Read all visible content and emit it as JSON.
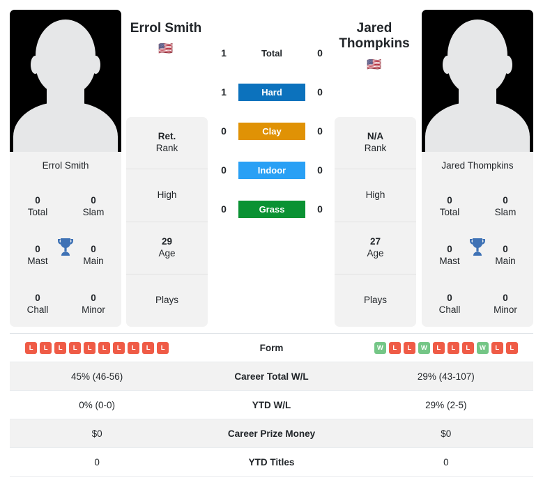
{
  "colors": {
    "hard": "#0c72bd",
    "clay": "#e09205",
    "indoor": "#29a0f5",
    "grass": "#0a9233",
    "win": "#74c686",
    "loss": "#ef5b46",
    "trophy": "#3f72b5",
    "card_bg": "#f2f2f2",
    "photo_bg": "#000000"
  },
  "players": {
    "left": {
      "name": "Errol Smith",
      "flag": "🇺🇸",
      "card_name": "Errol Smith",
      "titles": [
        {
          "value": "0",
          "label": "Total"
        },
        {
          "value": "0",
          "label": "Slam"
        },
        {
          "value": "0",
          "label": "Mast"
        },
        {
          "value": "0",
          "label": "Main"
        },
        {
          "value": "0",
          "label": "Chall"
        },
        {
          "value": "0",
          "label": "Minor"
        }
      ],
      "info": [
        {
          "value": "Ret.",
          "label": "Rank"
        },
        {
          "value": "",
          "label": "High"
        },
        {
          "value": "29",
          "label": "Age"
        },
        {
          "value": "",
          "label": "Plays"
        }
      ],
      "form": [
        "L",
        "L",
        "L",
        "L",
        "L",
        "L",
        "L",
        "L",
        "L",
        "L"
      ]
    },
    "right": {
      "name": "Jared Thompkins",
      "name_line1": "Jared",
      "name_line2": "Thompkins",
      "flag": "🇺🇸",
      "card_name": "Jared Thompkins",
      "titles": [
        {
          "value": "0",
          "label": "Total"
        },
        {
          "value": "0",
          "label": "Slam"
        },
        {
          "value": "0",
          "label": "Mast"
        },
        {
          "value": "0",
          "label": "Main"
        },
        {
          "value": "0",
          "label": "Chall"
        },
        {
          "value": "0",
          "label": "Minor"
        }
      ],
      "info": [
        {
          "value": "N/A",
          "label": "Rank"
        },
        {
          "value": "",
          "label": "High"
        },
        {
          "value": "27",
          "label": "Age"
        },
        {
          "value": "",
          "label": "Plays"
        }
      ],
      "form": [
        "W",
        "L",
        "L",
        "W",
        "L",
        "L",
        "L",
        "W",
        "L",
        "L"
      ]
    }
  },
  "h2h": [
    {
      "label": "Total",
      "left": "1",
      "right": "0",
      "style": "plain"
    },
    {
      "label": "Hard",
      "left": "1",
      "right": "0",
      "style": "hard"
    },
    {
      "label": "Clay",
      "left": "0",
      "right": "0",
      "style": "clay"
    },
    {
      "label": "Indoor",
      "left": "0",
      "right": "0",
      "style": "indoor"
    },
    {
      "label": "Grass",
      "left": "0",
      "right": "0",
      "style": "grass"
    }
  ],
  "stats_rows": [
    {
      "label": "Form",
      "left": "",
      "right": ""
    },
    {
      "label": "Career Total W/L",
      "left": "45% (46-56)",
      "right": "29% (43-107)"
    },
    {
      "label": "YTD W/L",
      "left": "0% (0-0)",
      "right": "29% (2-5)"
    },
    {
      "label": "Career Prize Money",
      "left": "$0",
      "right": "$0"
    },
    {
      "label": "YTD Titles",
      "left": "0",
      "right": "0"
    }
  ]
}
